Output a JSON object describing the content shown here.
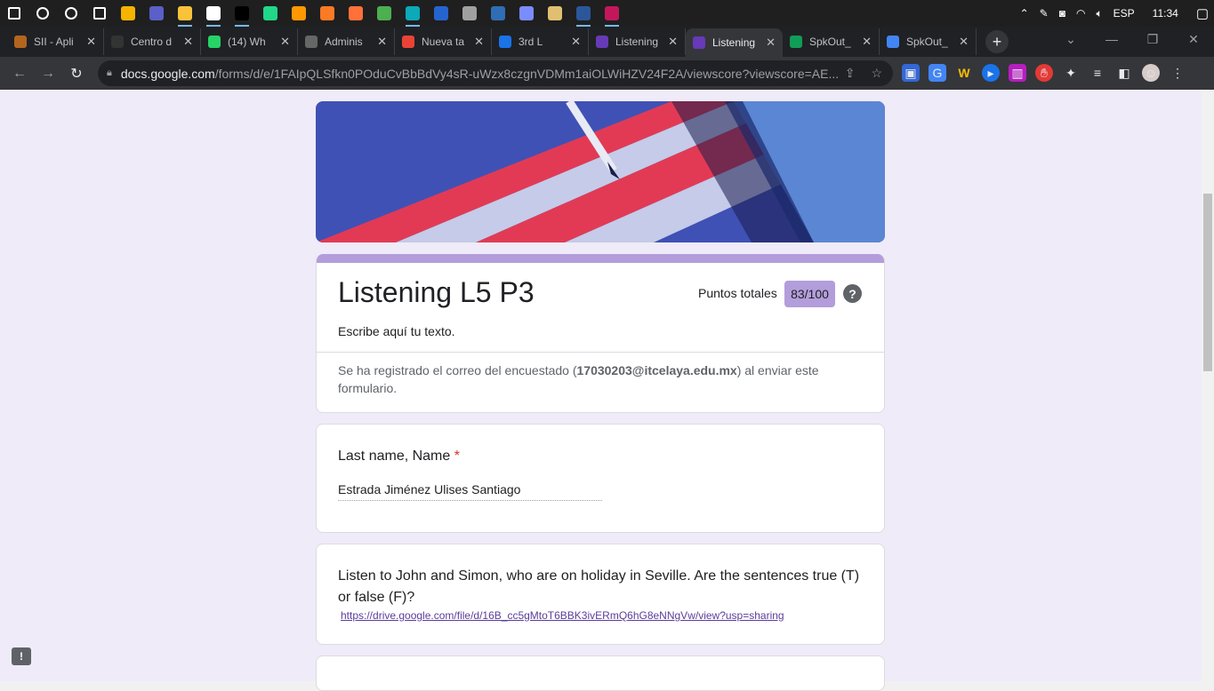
{
  "taskbar": {
    "apps": [
      {
        "icon": "windows-start-icon",
        "color": "#ffffff"
      },
      {
        "icon": "search-icon",
        "color": "#ffffff"
      },
      {
        "icon": "cortana-icon",
        "color": "#ffffff"
      },
      {
        "icon": "task-view-icon",
        "color": "#ffffff"
      },
      {
        "icon": "chrome-icon",
        "color": "#f4b400"
      },
      {
        "icon": "teams-icon",
        "color": "#5b5fc7"
      },
      {
        "icon": "file-explorer-icon",
        "color": "#f8c33a"
      },
      {
        "icon": "app-icon",
        "color": "#ffffff"
      },
      {
        "icon": "intellij-icon",
        "color": "#000000"
      },
      {
        "icon": "pycharm-icon",
        "color": "#21d789"
      },
      {
        "icon": "sublime-icon",
        "color": "#ff9800"
      },
      {
        "icon": "xampp-icon",
        "color": "#fb7a24"
      },
      {
        "icon": "firefox-icon",
        "color": "#ff7139"
      },
      {
        "icon": "app-icon",
        "color": "#4caf50"
      },
      {
        "icon": "edge-icon",
        "color": "#0ca9b8"
      },
      {
        "icon": "todo-icon",
        "color": "#2564cf"
      },
      {
        "icon": "calculator-icon",
        "color": "#a0a0a0"
      },
      {
        "icon": "virtualbox-icon",
        "color": "#2f6db5"
      },
      {
        "icon": "app-icon",
        "color": "#7b8cff"
      },
      {
        "icon": "tool-icon",
        "color": "#e0c070"
      },
      {
        "icon": "word-icon",
        "color": "#2b579a"
      },
      {
        "icon": "app-icon",
        "color": "#c2185b"
      }
    ],
    "tray": {
      "language": "ESP",
      "time": "11:34"
    }
  },
  "browser": {
    "tabs": [
      {
        "title": "SII - Apli",
        "favicon_color": "#b5651d",
        "active": false
      },
      {
        "title": "Centro d",
        "favicon_color": "#333333",
        "active": false
      },
      {
        "title": "(14) Wh",
        "favicon_color": "#25d366",
        "active": false
      },
      {
        "title": "Adminis",
        "favicon_color": "#666666",
        "active": false
      },
      {
        "title": "Nueva ta",
        "favicon_color": "#ea4335",
        "active": false
      },
      {
        "title": "3rd L",
        "favicon_color": "#1a73e8",
        "active": false
      },
      {
        "title": "Listening",
        "favicon_color": "#673ab7",
        "active": false
      },
      {
        "title": "Listening",
        "favicon_color": "#673ab7",
        "active": true
      },
      {
        "title": "SpkOut_",
        "favicon_color": "#0f9d58",
        "active": false
      },
      {
        "title": "SpkOut_",
        "favicon_color": "#4285f4",
        "active": false
      }
    ],
    "url_host": "docs.google.com",
    "url_path": "/forms/d/e/1FAIpQLSfkn0POduCvBbBdVy4sR-uWzx8czgnVDMm1aiOLWiHZV24F2A/viewscore?viewscore=AE..."
  },
  "form": {
    "title": "Listening L5 P3",
    "score_label": "Puntos totales",
    "score_value": "83/100",
    "description": "Escribe aquí tu texto.",
    "email_note_before": "Se ha registrado el correo del encuestado (",
    "email": "17030203@itcelaya.edu.mx",
    "email_note_after": ") al enviar este formulario.",
    "q1_title": "Last name, Name",
    "q1_required": "*",
    "q1_answer": "Estrada Jiménez Ulises Santiago",
    "q2_text": "Listen to John and Simon, who are on holiday in Seville. Are the sentences true (T) or false (F)?",
    "q2_link": "https://drive.google.com/file/d/16B_cc5gMtoT6BBK3ivERmQ6hG8eNNgVw/view?usp=sharing"
  }
}
